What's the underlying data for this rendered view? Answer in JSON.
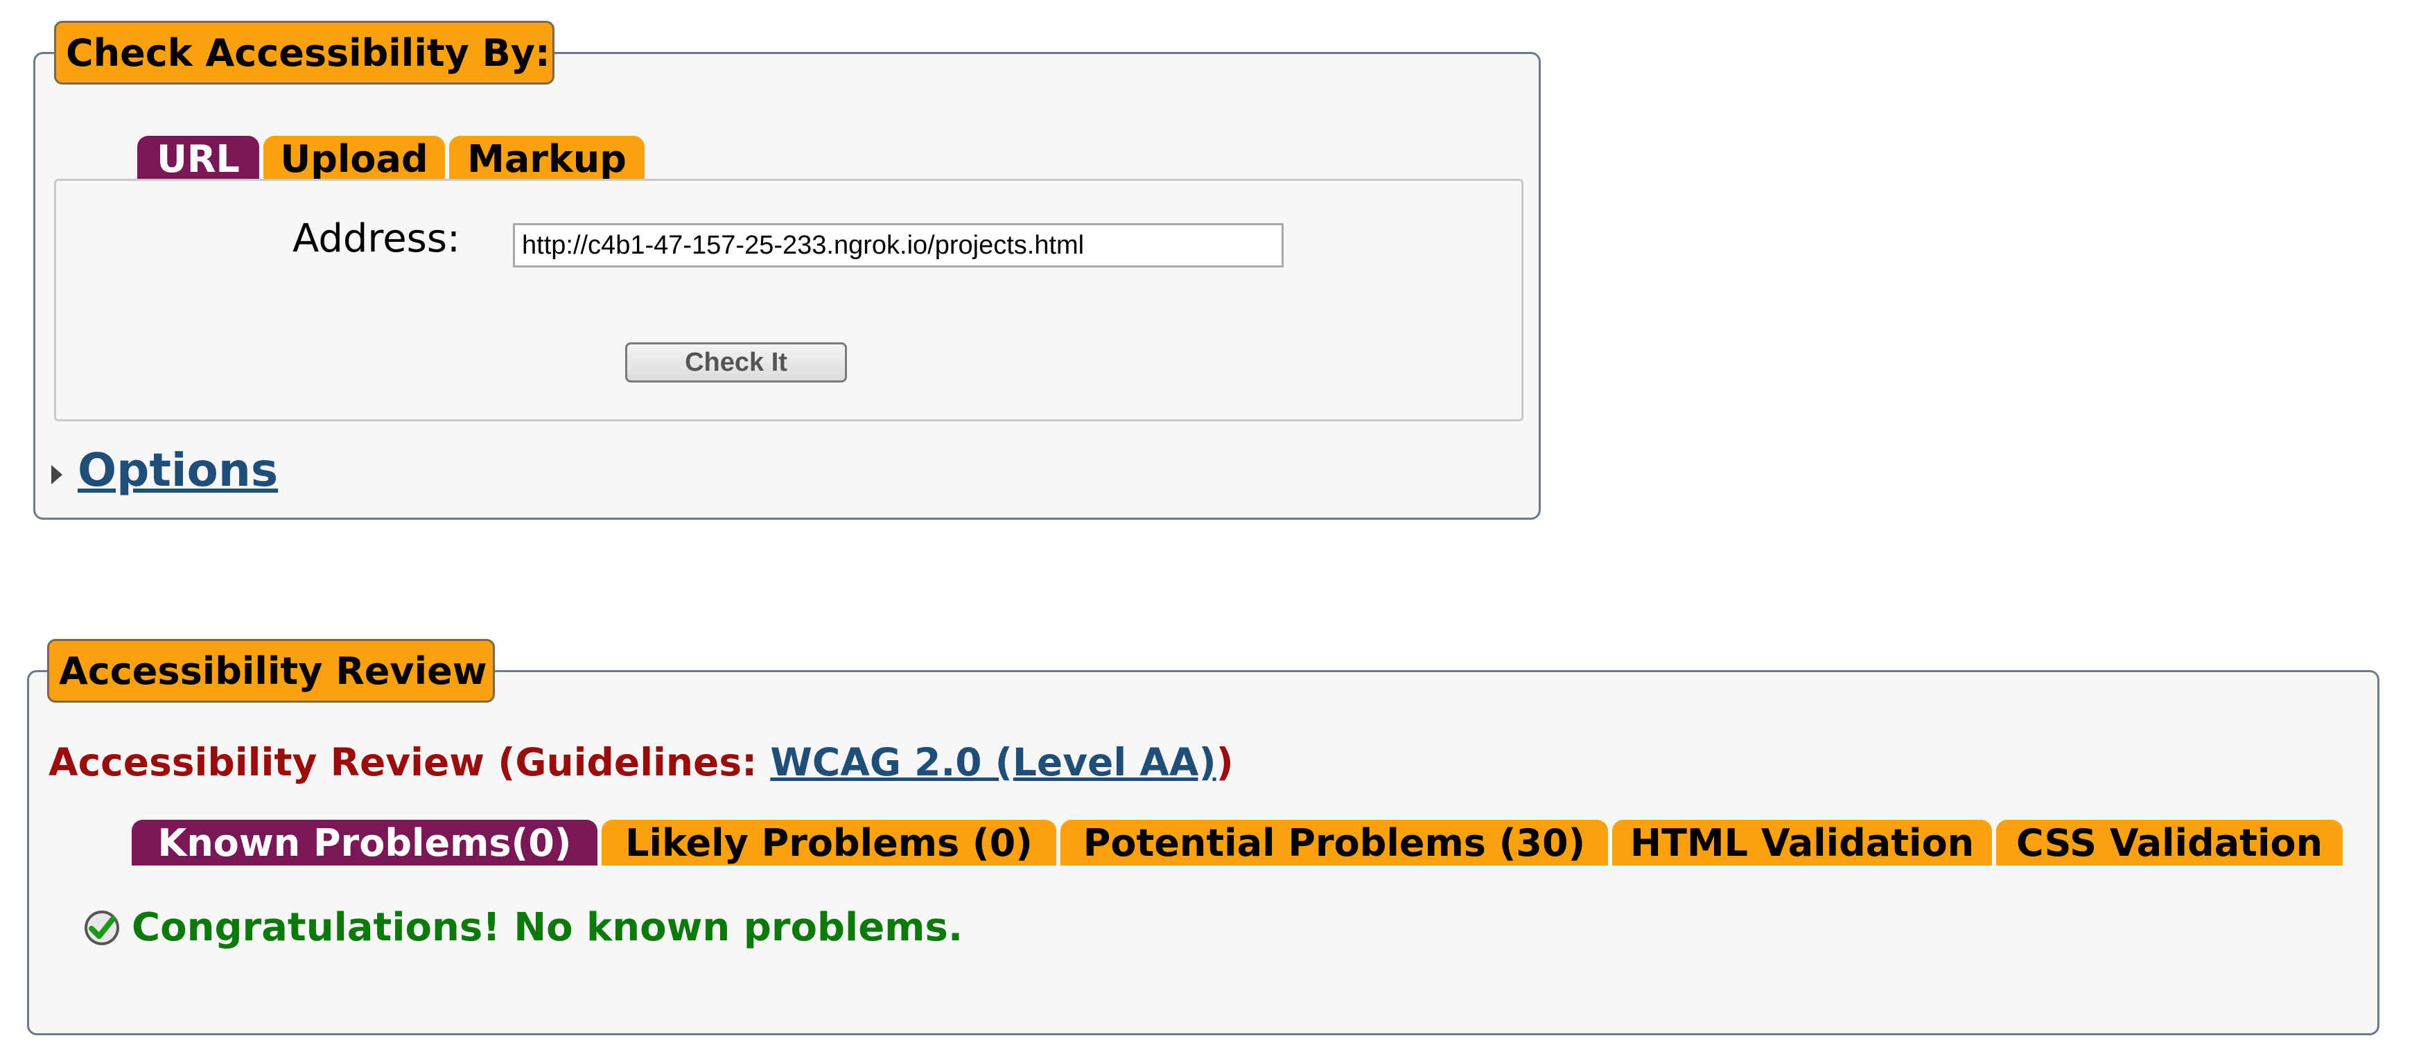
{
  "check_panel": {
    "legend": "Check Accessibility By:",
    "tabs": [
      {
        "label": "URL",
        "active": true
      },
      {
        "label": "Upload",
        "active": false
      },
      {
        "label": "Markup",
        "active": false
      }
    ],
    "address_label": "Address:",
    "address_value": "http://c4b1-47-157-25-233.ngrok.io/projects.html",
    "check_button": "Check It",
    "options_label": "Options"
  },
  "review_panel": {
    "legend": "Accessibility Review",
    "heading_prefix": "Accessibility Review (Guidelines: ",
    "guidelines_link": "WCAG 2.0 (Level AA)",
    "heading_suffix": ")",
    "tabs": [
      {
        "label": "Known Problems(0)",
        "active": true
      },
      {
        "label": "Likely Problems (0)",
        "active": false
      },
      {
        "label": "Potential Problems (30)",
        "active": false
      },
      {
        "label": "HTML Validation",
        "active": false
      },
      {
        "label": "CSS Validation",
        "active": false
      }
    ],
    "message": "Congratulations! No known problems."
  },
  "colors": {
    "tab_active": "#7a1756",
    "tab_inactive": "#fba10f",
    "heading_red": "#9b0d0d",
    "success_green": "#0b7a0b",
    "link_blue": "#1f4e79"
  },
  "icons": {
    "options_toggle": "triangle-right-icon",
    "success": "check-circle-icon"
  }
}
